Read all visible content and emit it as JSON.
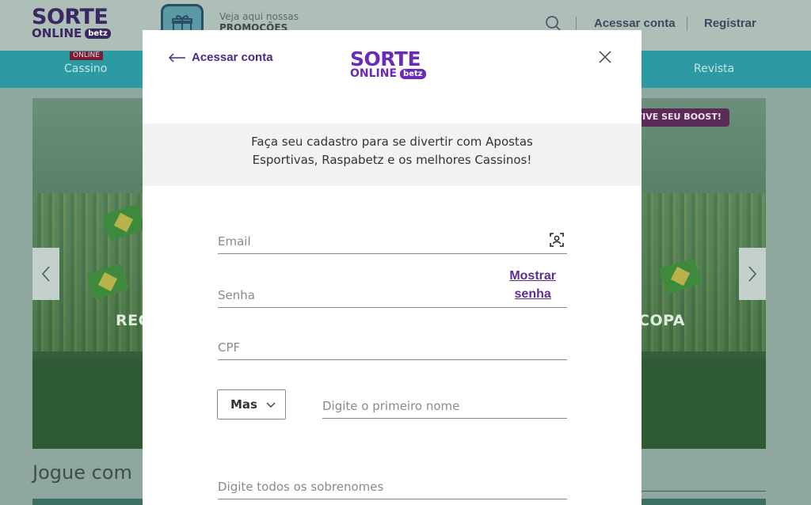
{
  "header": {
    "logo": {
      "word": "SORTE",
      "sub": "ONLINE",
      "badge": "betz"
    },
    "promo": {
      "line1": "Veja aqui nossas",
      "line2": "PROMOÇÕES"
    },
    "login_label": "Acessar conta",
    "register_label": "Registrar"
  },
  "nav": {
    "badge": "ONLINE",
    "items": [
      "Cassino",
      "Revista"
    ]
  },
  "banner": {
    "boost_label": "ATIVE SEU BOOST!",
    "text_left": "REC",
    "text_right": "COPA"
  },
  "section": {
    "title": "Jogue com"
  },
  "modal": {
    "back_label": "Acessar conta",
    "logo": {
      "word": "SORTE",
      "sub": "ONLINE",
      "badge": "betz"
    },
    "intro_line1": "Faça seu cadastro para se divertir com Apostas",
    "intro_line2": "Esportivas, Raspabetz e os melhores Cassinos!",
    "fields": {
      "email_placeholder": "Email",
      "password_placeholder": "Senha",
      "show_password_line1": "Mostrar",
      "show_password_line2": "senha",
      "cpf_placeholder": "CPF",
      "gender_value": "Mas",
      "first_name_placeholder": "Digite o primeiro nome",
      "last_name_placeholder": "Digite todos os sobrenomes"
    }
  },
  "colors": {
    "brand_purple": "#6a2bb8",
    "link_purple": "#5b2d95",
    "nav_teal": "#2c9aa3"
  },
  "icons": [
    "gift-icon",
    "search-icon",
    "arrow-left-icon",
    "close-icon",
    "face-id-icon",
    "chevron-down-icon",
    "chevron-left-icon",
    "chevron-right-icon"
  ]
}
